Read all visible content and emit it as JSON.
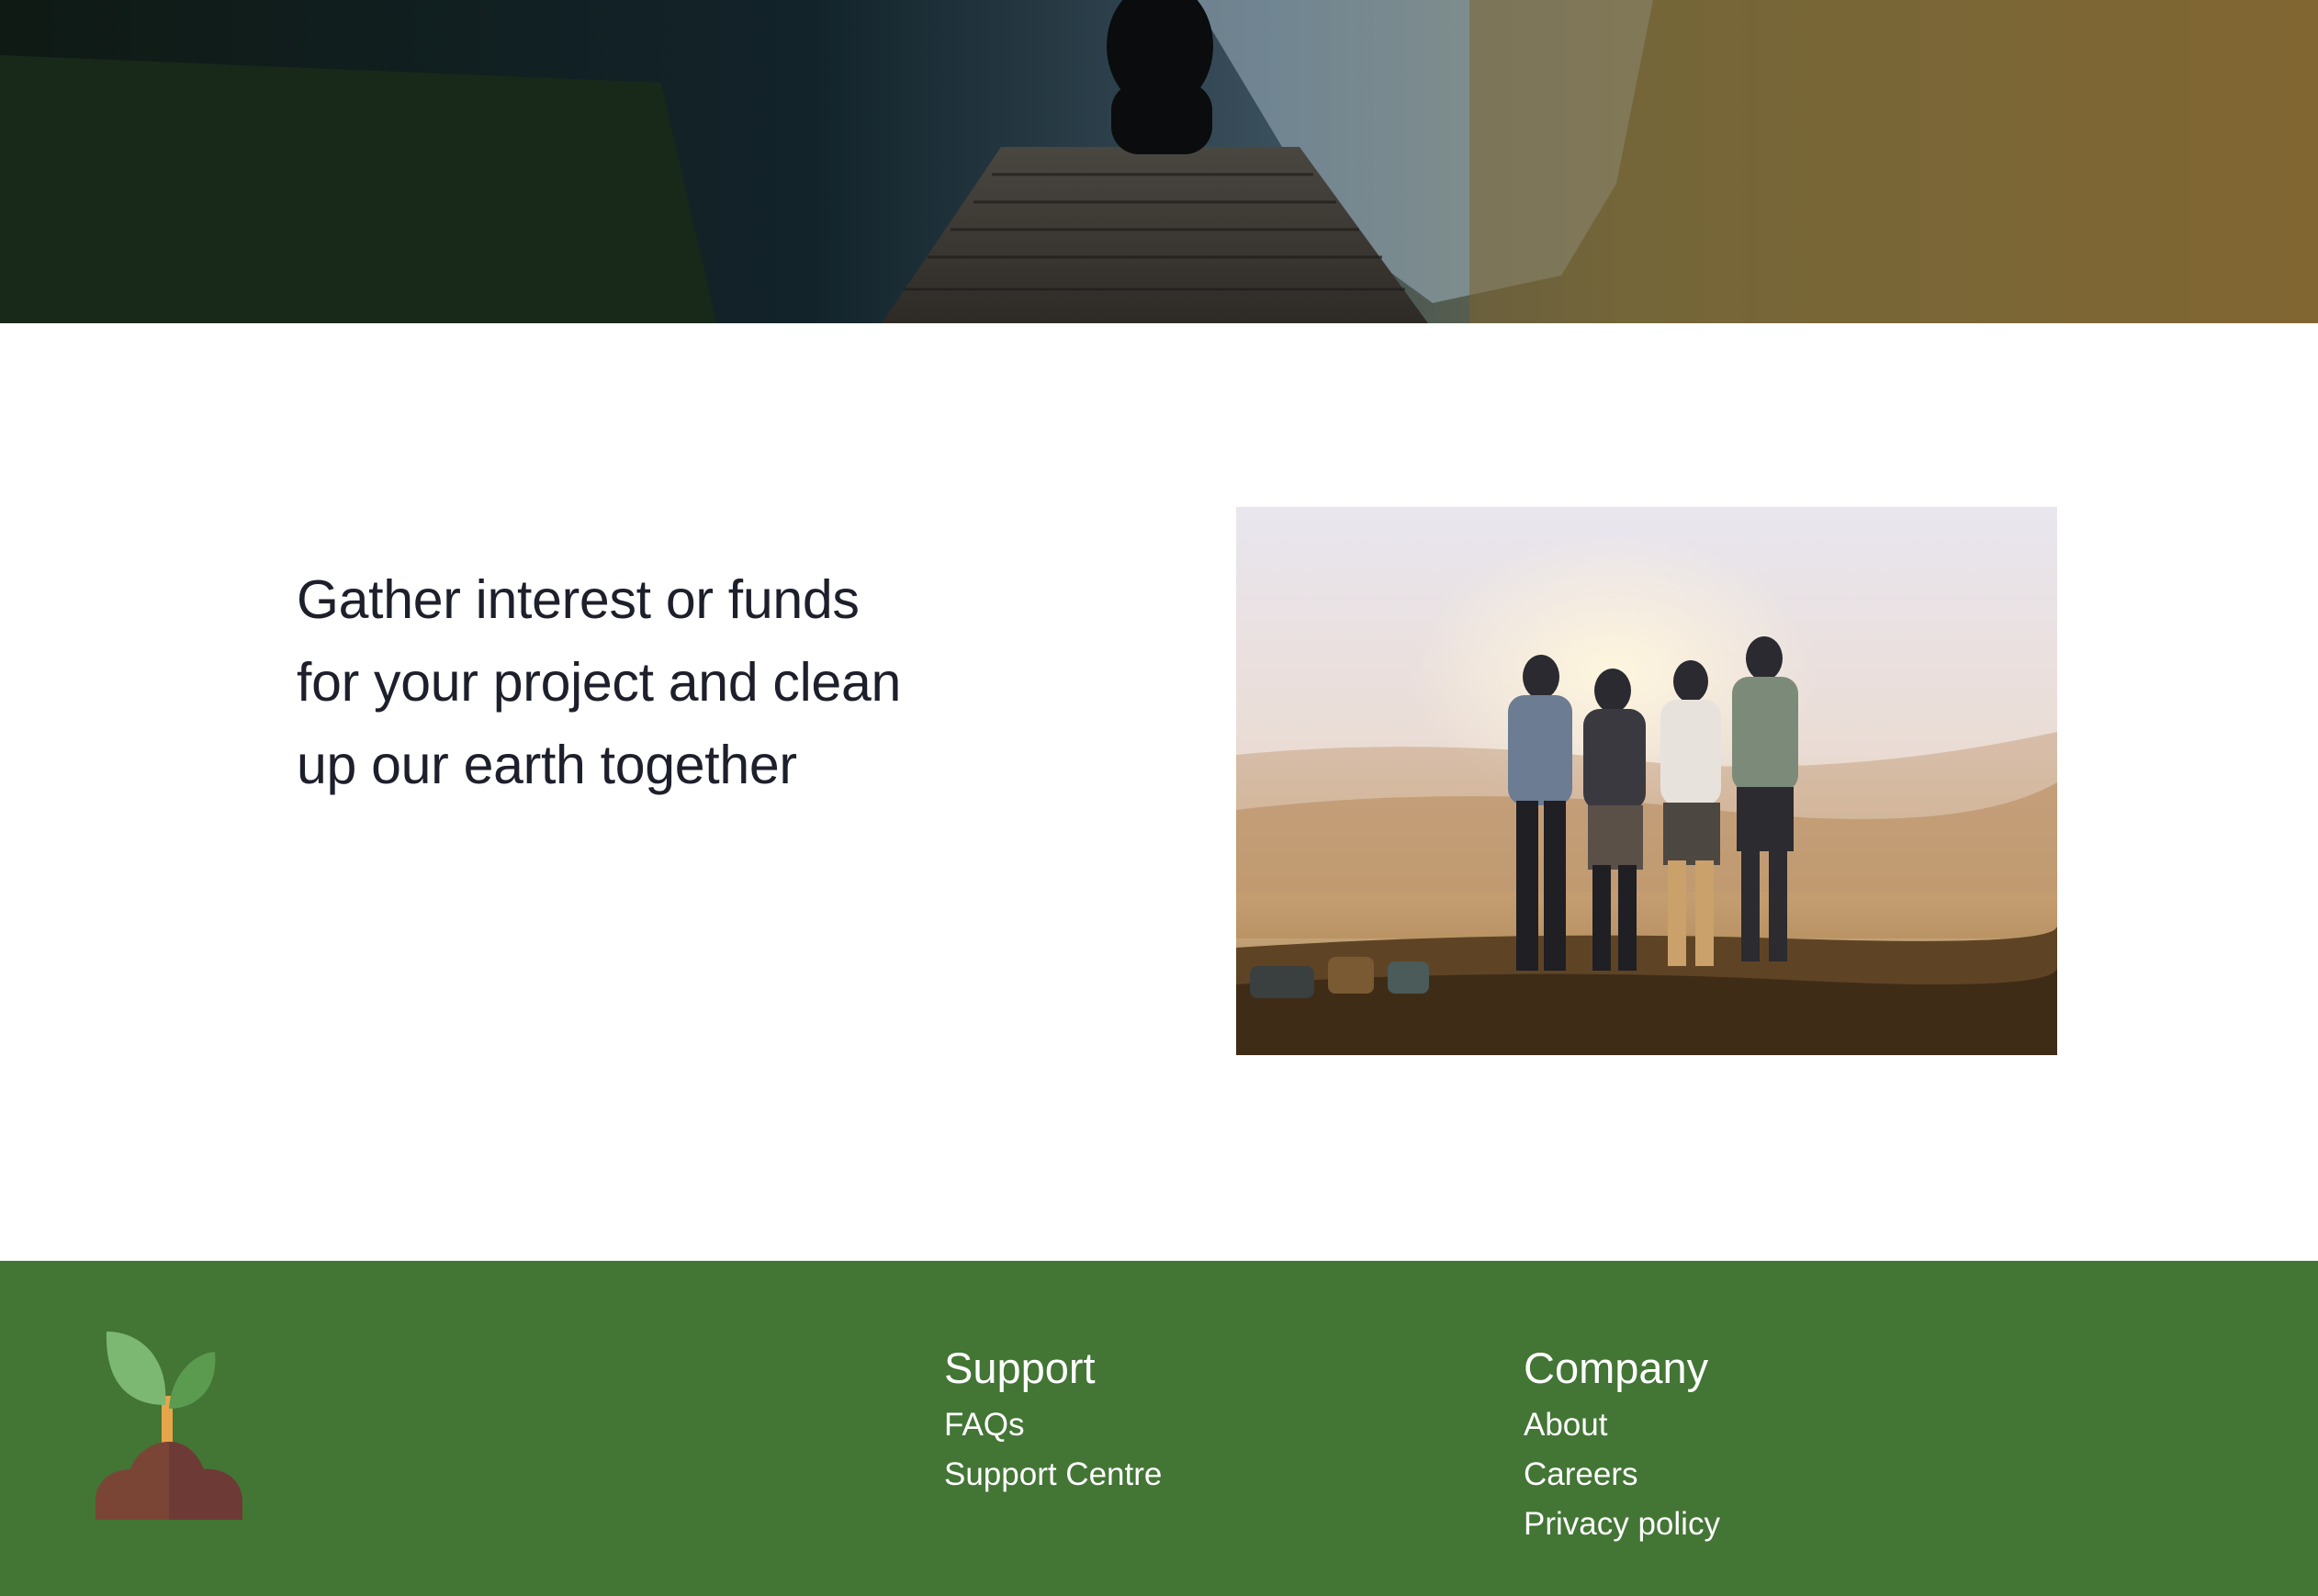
{
  "hero": {
    "image": "lake-dock-person-photo"
  },
  "feature": {
    "headline_lines": [
      "Gather interest or funds",
      "for your project and clean",
      "up our earth together"
    ],
    "image": "friends-sunset-hill-photo"
  },
  "footer": {
    "logo": "sprout-icon",
    "columns": [
      {
        "title": "Support",
        "links": [
          "FAQs",
          "Support Centre"
        ]
      },
      {
        "title": "Company",
        "links": [
          "About",
          "Careers",
          "Privacy policy"
        ]
      }
    ]
  },
  "colors": {
    "footer_bg": "#437535",
    "text_dark": "#1d1f2b",
    "footer_text": "#ffffff"
  }
}
